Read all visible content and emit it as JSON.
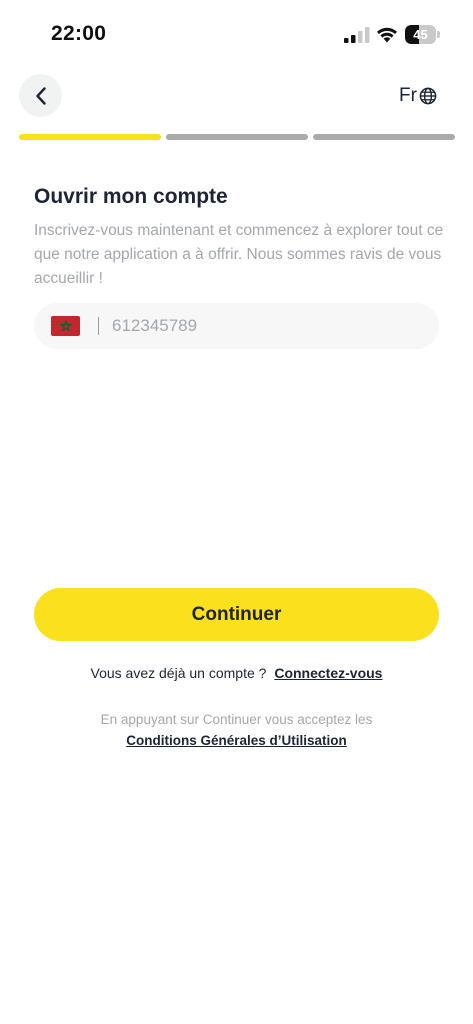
{
  "status_bar": {
    "time": "22:00",
    "battery_level": "45",
    "icons": [
      "signal-icon",
      "wifi-icon",
      "battery-icon"
    ]
  },
  "header": {
    "back_icon": "chevron-left-icon",
    "language": "Fr",
    "language_icon": "globe-icon"
  },
  "progress": {
    "total_steps": 3,
    "current_step": 1,
    "active_color": "#fbe01e",
    "inactive_color": "#ababab"
  },
  "form": {
    "title": "Ouvrir mon compte",
    "subtitle": "Inscrivez-vous maintenant et commencez à explorer tout ce que notre application a à offrir. Nous sommes ravis de vous accueillir !",
    "phone": {
      "country_flag": "morocco-flag-icon",
      "placeholder": "612345789",
      "value": ""
    },
    "continue_label": "Continuer"
  },
  "footer": {
    "have_account_text": "Vous avez déjà un compte ?",
    "login_link": "Connectez-vous",
    "terms_text": "En appuyant sur Continuer vous acceptez les",
    "terms_link": "Conditions Générales d’Utilisation"
  },
  "colors": {
    "accent": "#fbe01e",
    "text_dark": "#1d2433",
    "text_muted": "#a4a7ab",
    "field_bg": "#f6f7f6"
  }
}
